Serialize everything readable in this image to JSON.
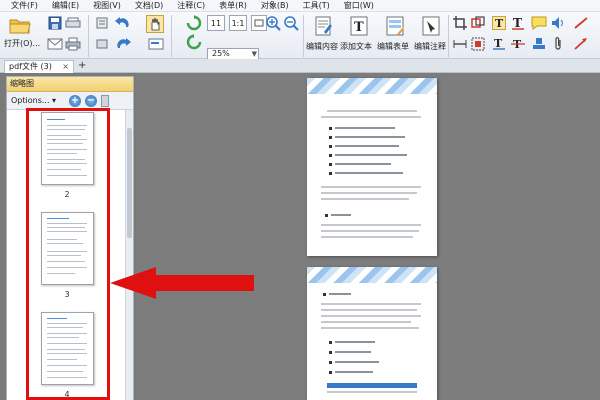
{
  "menu": {
    "items": [
      "文件(F)",
      "编辑(E)",
      "视图(V)",
      "文档(D)",
      "注释(C)",
      "表单(R)",
      "对象(B)",
      "工具(T)",
      "窗口(W)"
    ]
  },
  "toolbar": {
    "open_label": "打开(O)...",
    "zoom_value": "25%",
    "page_label_1": "11",
    "page_label_2": "1:1",
    "edit_content_label": "编辑内容",
    "add_text_label": "添加文本",
    "edit_form_label": "编辑表单",
    "edit_annot_label": "编辑注释"
  },
  "tabs": {
    "doc_tab_label": "pdf文件 (3)",
    "close_glyph": "×",
    "new_tab_glyph": "+"
  },
  "panel": {
    "title": "缩略图",
    "options_label": "Options...",
    "thumbnails": [
      {
        "page_number": "2"
      },
      {
        "page_number": "3"
      },
      {
        "page_number": "4"
      }
    ]
  },
  "colors": {
    "annotation_red": "#e01010",
    "panel_header": "#f1d173",
    "accent_blue": "#2e6fb3"
  }
}
